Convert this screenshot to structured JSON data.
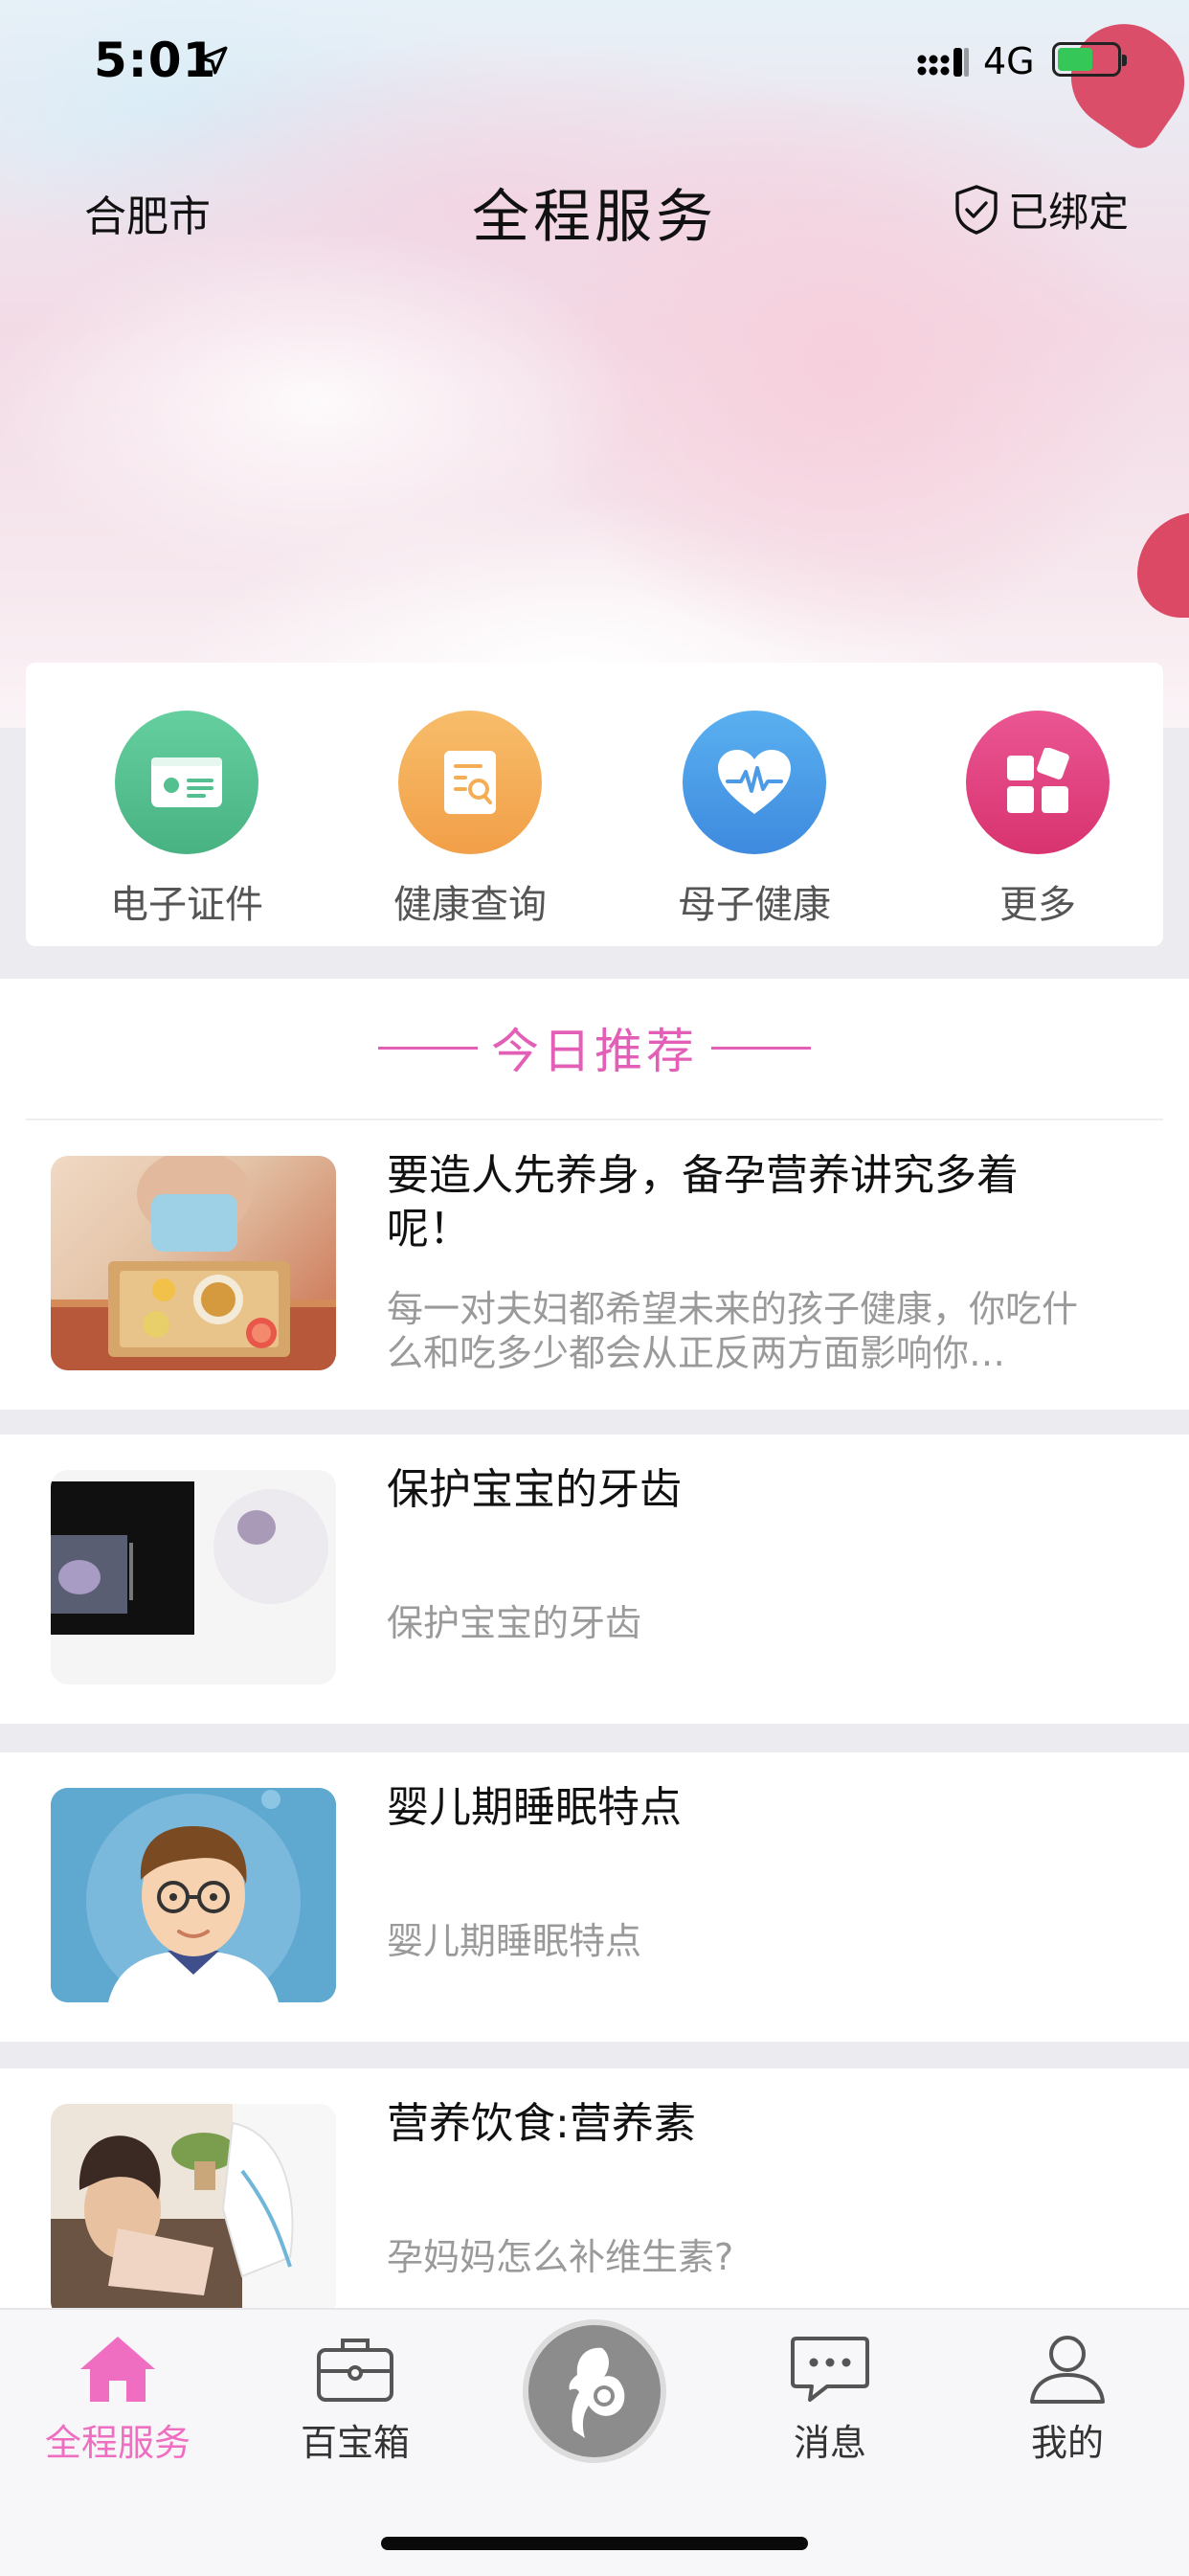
{
  "status_bar": {
    "time": "5:01",
    "network": "4G"
  },
  "nav": {
    "city": "合肥市",
    "title": "全程服务",
    "bind_label": "已绑定"
  },
  "quick_services": [
    {
      "label": "电子证件",
      "icon": "id-card-icon",
      "color": "#55c08f"
    },
    {
      "label": "健康查询",
      "icon": "document-search-icon",
      "color": "#f4ae55"
    },
    {
      "label": "母子健康",
      "icon": "heart-pulse-icon",
      "color": "#4d9be6"
    },
    {
      "label": "更多",
      "icon": "apps-icon",
      "color": "#e2427f"
    }
  ],
  "recommend": {
    "title": "今日推荐",
    "articles": [
      {
        "title": "要造人先养身，备孕营养讲究多着呢！",
        "summary": "每一对夫妇都希望未来的孩子健康，你吃什么和吃多少都会从正反两方面影响你…"
      },
      {
        "title": "保护宝宝的牙齿",
        "summary": "保护宝宝的牙齿"
      },
      {
        "title": "婴儿期睡眠特点",
        "summary": "婴儿期睡眠特点"
      },
      {
        "title": "营养饮食:营养素",
        "summary": "孕妈妈怎么补维生素?"
      }
    ]
  },
  "tabbar": {
    "items": [
      {
        "label": "全程服务",
        "icon": "home-icon",
        "active": true
      },
      {
        "label": "百宝箱",
        "icon": "toolbox-icon",
        "active": false
      },
      {
        "label": "消息",
        "icon": "message-icon",
        "active": false
      },
      {
        "label": "我的",
        "icon": "user-icon",
        "active": false
      }
    ],
    "center_icon": "mother-baby-icon"
  },
  "colors": {
    "accent": "#ef6ec1",
    "recommend": "#e35fb7"
  }
}
